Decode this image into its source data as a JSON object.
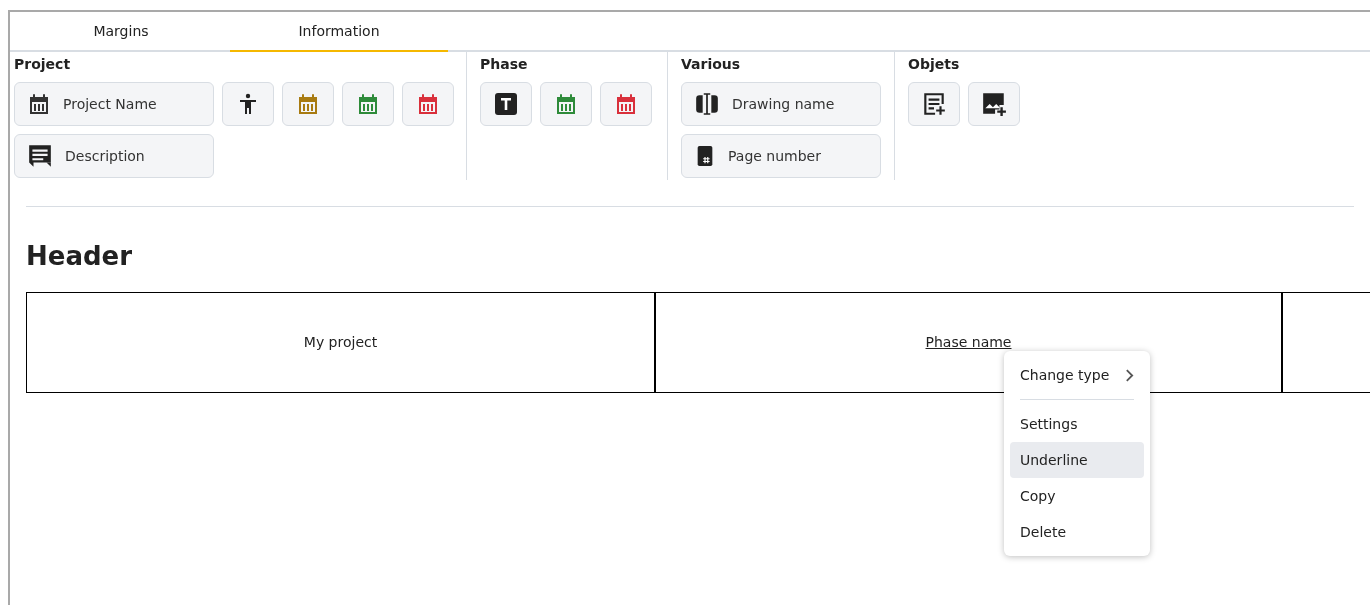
{
  "tabs": [
    {
      "label": "Margins",
      "selected": false
    },
    {
      "label": "Information",
      "selected": true
    }
  ],
  "groups": [
    {
      "title": "Project",
      "buttons": [
        {
          "kind": "calendar",
          "label": "Project Name",
          "color": "#333333"
        },
        {
          "kind": "person"
        },
        {
          "kind": "calendar",
          "color": "#a87b12"
        },
        {
          "kind": "calendar",
          "color": "#2e8b3a"
        },
        {
          "kind": "calendar",
          "color": "#d9303c"
        },
        {
          "kind": "comment",
          "label": "Description"
        }
      ]
    },
    {
      "title": "Phase",
      "buttons": [
        {
          "kind": "text"
        },
        {
          "kind": "calendar",
          "color": "#2e8b3a"
        },
        {
          "kind": "calendar",
          "color": "#d9303c"
        }
      ]
    },
    {
      "title": "Various",
      "buttons": [
        {
          "kind": "cursor",
          "label": "Drawing name"
        },
        {
          "kind": "page",
          "label": "Page number"
        }
      ]
    },
    {
      "title": "Objets",
      "buttons": [
        {
          "kind": "note-add"
        },
        {
          "kind": "image-add"
        }
      ]
    }
  ],
  "header": {
    "title": "Header",
    "cells": [
      {
        "text": "My project",
        "underlined": false
      },
      {
        "text": "Phase name",
        "underlined": true
      },
      {}
    ]
  },
  "context_menu": {
    "items": [
      {
        "kind": "item",
        "label": "Change type",
        "submenu": true,
        "selected": false
      },
      {
        "kind": "separator"
      },
      {
        "kind": "item",
        "label": "Settings",
        "submenu": false,
        "selected": false
      },
      {
        "kind": "item",
        "label": "Underline",
        "submenu": false,
        "selected": true
      },
      {
        "kind": "item",
        "label": "Copy",
        "submenu": false,
        "selected": false
      },
      {
        "kind": "item",
        "label": "Delete",
        "submenu": false,
        "selected": false
      }
    ]
  }
}
